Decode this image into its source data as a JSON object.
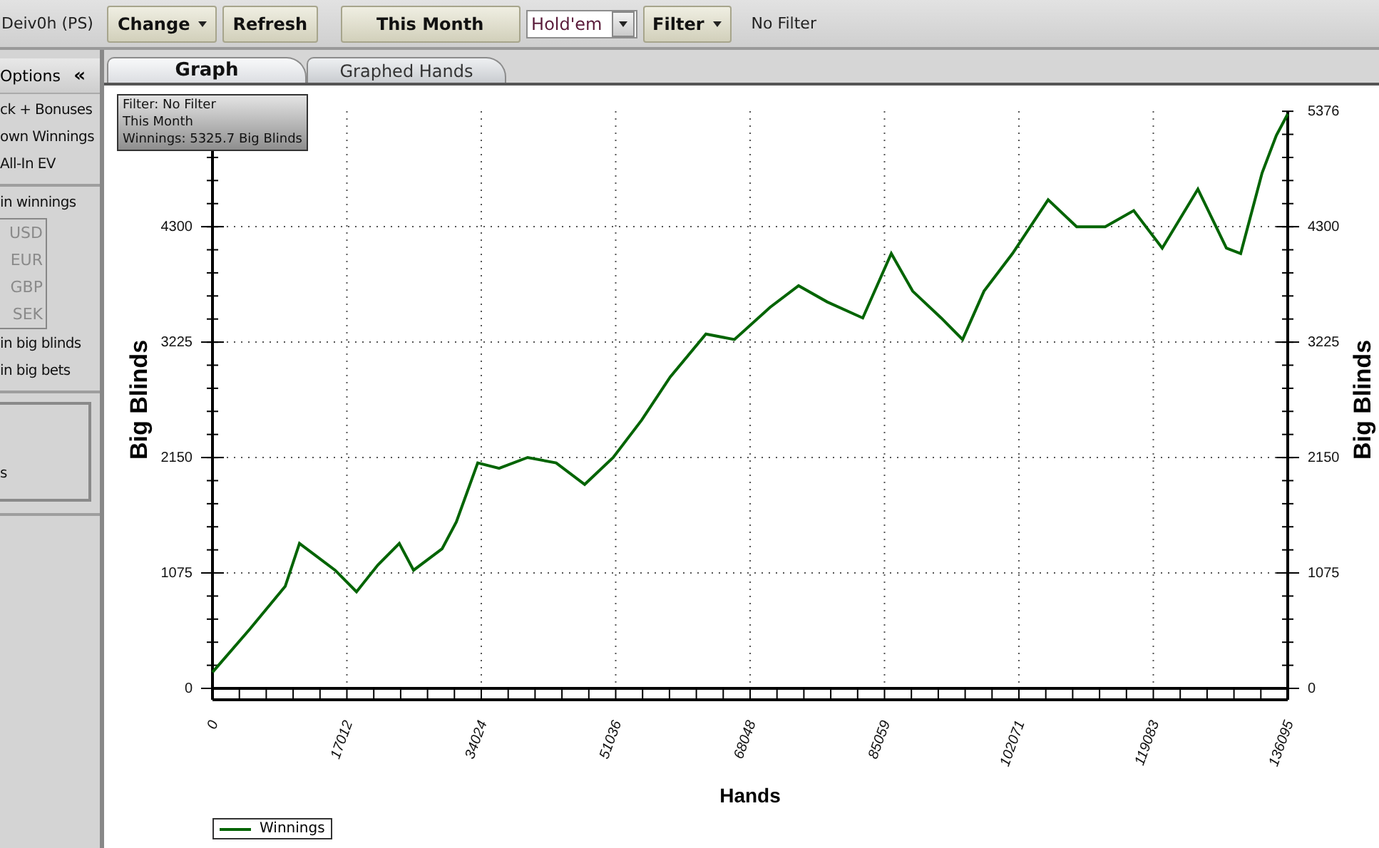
{
  "toolbar": {
    "account": "Deiv0h (PS)",
    "buttons": [
      {
        "label": "Change",
        "dropdown": true
      },
      {
        "label": "Refresh",
        "dropdown": false
      }
    ],
    "period": "This Month",
    "game_select": {
      "value": "Hold'em"
    },
    "filter_button": {
      "label": "Filter",
      "dropdown": true
    },
    "filter_status": "No Filter"
  },
  "sidebar": {
    "title": "Options",
    "collapse": "«",
    "groups": [
      {
        "entries": [
          {
            "kind": "option",
            "label": "ck + Bonuses"
          },
          {
            "kind": "option",
            "label": "own Winnings"
          },
          {
            "kind": "option",
            "label": "All-In EV"
          }
        ]
      },
      {
        "entries": [
          {
            "kind": "option",
            "label": "in winnings"
          },
          {
            "kind": "currency-box",
            "currencies": [
              {
                "label": "USD",
                "disabled": true
              },
              {
                "label": "EUR",
                "disabled": true
              },
              {
                "label": "GBP",
                "disabled": true
              },
              {
                "label": "SEK",
                "disabled": true
              }
            ]
          },
          {
            "kind": "option",
            "label": "in big blinds"
          },
          {
            "kind": "option",
            "label": "in big bets"
          }
        ]
      },
      {
        "entries": [
          {
            "kind": "box",
            "label": "s"
          }
        ]
      }
    ]
  },
  "tabs": [
    {
      "label": "Graph",
      "selected": true
    },
    {
      "label": "Graphed Hands",
      "selected": false
    }
  ],
  "tooltip": [
    "Filter: No Filter",
    "This Month",
    "Winnings: 5325.7 Big Blinds"
  ],
  "chart_data": {
    "type": "line",
    "xlabel": "Hands",
    "ylabel": "Big Blinds",
    "y2label": "Big Blinds",
    "xlim": [
      0,
      136095
    ],
    "ylim": [
      0,
      5376
    ],
    "xticks": [
      0,
      17012,
      34024,
      51036,
      68048,
      85059,
      102071,
      119083,
      136095
    ],
    "yticks": [
      0,
      1075,
      2150,
      3225,
      4300
    ],
    "y2lim": [
      0,
      5376
    ],
    "y2ticks": [
      0,
      1075,
      2150,
      3225,
      4300,
      5376
    ],
    "grid": true,
    "x": [
      0,
      4693,
      9205,
      11010,
      12815,
      15523,
      18230,
      20938,
      23645,
      25450,
      29060,
      30866,
      33573,
      36280,
      39890,
      43500,
      47110,
      50720,
      54330,
      57940,
      62453,
      66063,
      70575,
      74185,
      77795,
      82308,
      85918,
      88625,
      92235,
      94943,
      97650,
      101260,
      105773,
      109383,
      112993,
      116603,
      120213,
      124725,
      128335,
      130140,
      132848,
      134653,
      136095
    ],
    "series": [
      {
        "name": "Winnings",
        "color": "#006400",
        "values": [
          150,
          550,
          950,
          1350,
          1250,
          1100,
          900,
          1150,
          1350,
          1100,
          1300,
          1550,
          2100,
          2050,
          2150,
          2100,
          1900,
          2150,
          2500,
          2900,
          3300,
          3250,
          3550,
          3750,
          3600,
          3450,
          4050,
          3700,
          3450,
          3250,
          3700,
          4050,
          4550,
          4300,
          4300,
          4450,
          4100,
          4650,
          4100,
          4050,
          4800,
          5150,
          5350
        ]
      }
    ]
  }
}
